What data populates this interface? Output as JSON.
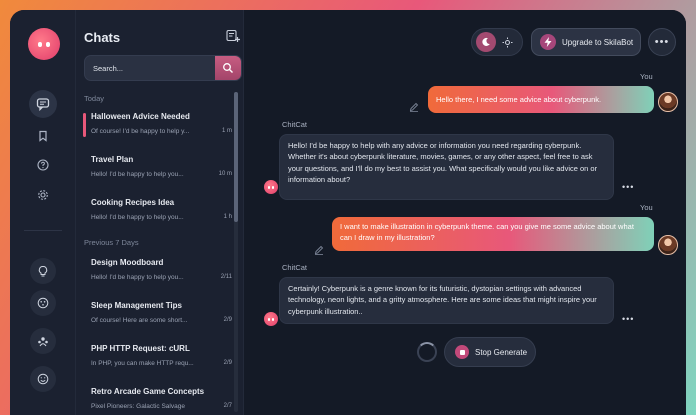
{
  "sidebar_title": "Chats",
  "search": {
    "placeholder": "Search..."
  },
  "sections": {
    "today": "Today",
    "previous": "Previous 7 Days"
  },
  "chats": [
    {
      "name": "Halloween Advice Needed",
      "preview": "Of course! I'd be happy to help y...",
      "time": "1 m"
    },
    {
      "name": "Travel Plan",
      "preview": "Hello! I'd be happy to help you...",
      "time": "10 m"
    },
    {
      "name": "Cooking Recipes Idea",
      "preview": "Hello! I'd be happy to help you...",
      "time": "1 h"
    },
    {
      "name": "Design Moodboard",
      "preview": "Hello! I'd be happy to help you...",
      "time": "2/11"
    },
    {
      "name": "Sleep Management Tips",
      "preview": "Of course! Here are some short...",
      "time": "2/9"
    },
    {
      "name": "PHP HTTP Request: cURL",
      "preview": "In PHP, you can make HTTP requ...",
      "time": "2/9"
    },
    {
      "name": "Retro Arcade Game Concepts",
      "preview": "Pixel Pioneers: Galactic Salvage",
      "time": "2/7"
    }
  ],
  "header": {
    "upgrade_label": "Upgrade to SkilaBot"
  },
  "messages": [
    {
      "sender": "You",
      "text": "Hello there, I need some advice about cyberpunk."
    },
    {
      "sender": "ChitCat",
      "text": "Hello! I'd be happy to help with any advice or information you need regarding cyberpunk. Whether it's about cyberpunk literature, movies, games, or any other aspect, feel free to ask your questions, and I'll do my best to assist you. What specifically would you like advice on or information about?"
    },
    {
      "sender": "You",
      "text": "I want to make illustration in cyberpunk theme. can you give me some advice about what can I draw in my illustration?"
    },
    {
      "sender": "ChitCat",
      "text": "Certainly! Cyberpunk is a genre known for its futuristic, dystopian settings with advanced technology, neon lights, and a gritty atmosphere. Here are some ideas that might inspire your cyberpunk illustration.."
    }
  ],
  "stop_label": "Stop Generate",
  "colors": {
    "accent": "#e8587a",
    "background": "#141a26",
    "panel": "#1b2130"
  }
}
